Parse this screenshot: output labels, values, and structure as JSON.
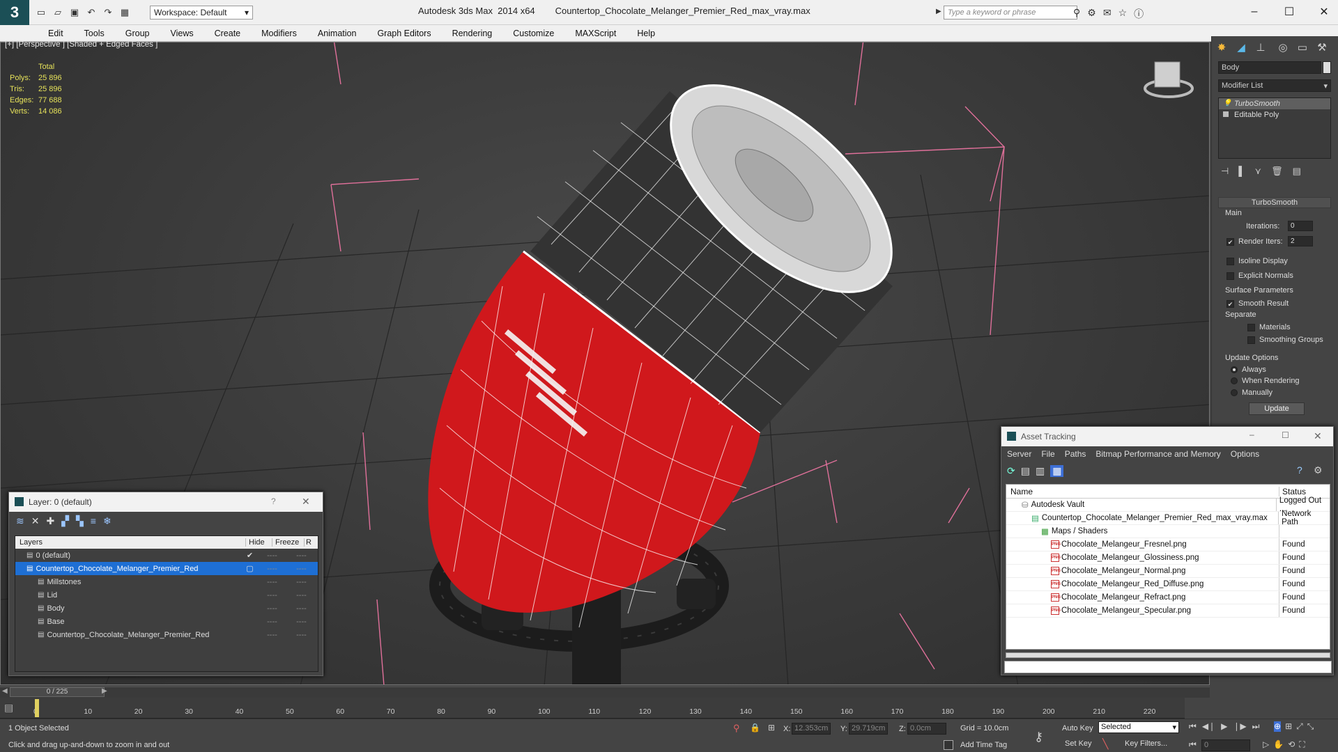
{
  "window": {
    "app_name": "Autodesk 3ds Max  2014 x64",
    "file_name": "Countertop_Chocolate_Melanger_Premier_Red_max_vray.max",
    "workspace": "Workspace: Default",
    "search_placeholder": "Type a keyword or phrase"
  },
  "menu": [
    "Edit",
    "Tools",
    "Group",
    "Views",
    "Create",
    "Modifiers",
    "Animation",
    "Graph Editors",
    "Rendering",
    "Customize",
    "MAXScript",
    "Help"
  ],
  "viewport": {
    "label": "[+] [Perspective ] [Shaded + Edged Faces ]",
    "stats": {
      "header": "Total",
      "rows": [
        {
          "k": "Polys:",
          "v": "25 896"
        },
        {
          "k": "Tris:",
          "v": "25 896"
        },
        {
          "k": "Edges:",
          "v": "77 688"
        },
        {
          "k": "Verts:",
          "v": "14 086"
        }
      ]
    }
  },
  "command_panel": {
    "object_name": "Body",
    "modifier_list": "Modifier List",
    "stack": [
      "TurboSmooth",
      "Editable Poly"
    ],
    "turbosmooth": {
      "title": "TurboSmooth",
      "main": "Main",
      "iterations_label": "Iterations:",
      "iterations": "0",
      "render_iters_label": "Render Iters:",
      "render_iters": "2",
      "isoline": "Isoline Display",
      "explicit_normals": "Explicit Normals",
      "surface_params": "Surface Parameters",
      "smooth_result": "Smooth Result",
      "separate": "Separate",
      "materials": "Materials",
      "smoothing_groups": "Smoothing Groups",
      "update_options": "Update Options",
      "always": "Always",
      "when_rendering": "When Rendering",
      "manually": "Manually",
      "update": "Update"
    }
  },
  "layer_dialog": {
    "title": "Layer: 0 (default)",
    "help": "?",
    "columns": {
      "layers": "Layers",
      "hide": "Hide",
      "freeze": "Freeze",
      "r": "R"
    },
    "rows": [
      {
        "name": "0 (default)",
        "indent": 1,
        "selected": false,
        "check": true
      },
      {
        "name": "Countertop_Chocolate_Melanger_Premier_Red",
        "indent": 1,
        "selected": true,
        "check": false
      },
      {
        "name": "Millstones",
        "indent": 2,
        "selected": false,
        "check": false
      },
      {
        "name": "Lid",
        "indent": 2,
        "selected": false,
        "check": false
      },
      {
        "name": "Body",
        "indent": 2,
        "selected": false,
        "check": false
      },
      {
        "name": "Base",
        "indent": 2,
        "selected": false,
        "check": false
      },
      {
        "name": "Countertop_Chocolate_Melanger_Premier_Red",
        "indent": 2,
        "selected": false,
        "check": false
      }
    ],
    "dash": "----"
  },
  "asset_tracking": {
    "title": "Asset Tracking",
    "menu": [
      "Server",
      "File",
      "Paths",
      "Bitmap Performance and Memory",
      "Options"
    ],
    "columns": {
      "name": "Name",
      "status": "Status"
    },
    "rows": [
      {
        "name": "Autodesk Vault",
        "status": "Logged Out ...",
        "level": 0,
        "icon": "vault"
      },
      {
        "name": "Countertop_Chocolate_Melanger_Premier_Red_max_vray.max",
        "status": "Network Path",
        "level": 1,
        "icon": "file"
      },
      {
        "name": "Maps / Shaders",
        "status": "",
        "level": 2,
        "icon": "maps"
      },
      {
        "name": "Chocolate_Melangeur_Fresnel.png",
        "status": "Found",
        "level": 3,
        "icon": "png"
      },
      {
        "name": "Chocolate_Melangeur_Glossiness.png",
        "status": "Found",
        "level": 3,
        "icon": "png"
      },
      {
        "name": "Chocolate_Melangeur_Normal.png",
        "status": "Found",
        "level": 3,
        "icon": "png"
      },
      {
        "name": "Chocolate_Melangeur_Red_Diffuse.png",
        "status": "Found",
        "level": 3,
        "icon": "png"
      },
      {
        "name": "Chocolate_Melangeur_Refract.png",
        "status": "Found",
        "level": 3,
        "icon": "png"
      },
      {
        "name": "Chocolate_Melangeur_Specular.png",
        "status": "Found",
        "level": 3,
        "icon": "png"
      }
    ]
  },
  "timeline": {
    "frame": "0 / 225",
    "ticks": [
      "0",
      "10",
      "20",
      "30",
      "40",
      "50",
      "60",
      "70",
      "80",
      "90",
      "100",
      "110",
      "120",
      "130",
      "140",
      "150",
      "160",
      "170",
      "180",
      "190",
      "200",
      "210",
      "220"
    ]
  },
  "status": {
    "selection": "1 Object Selected",
    "prompt": "Click and drag up-and-down to zoom in and out",
    "x_label": "X:",
    "x": "12.353cm",
    "y_label": "Y:",
    "y": "29.719cm",
    "z_label": "Z:",
    "z": "0.0cm",
    "grid": "Grid = 10.0cm",
    "add_time_tag": "Add Time Tag",
    "auto_key": "Auto Key",
    "auto_key_value": "Selected",
    "set_key": "Set Key",
    "key_filters": "Key Filters...",
    "frame_value": "0"
  },
  "colors": {
    "accent": "#1e6fd4",
    "model_red": "#d0181c",
    "model_dark": "#333333",
    "grid_pink": "#e0709a",
    "stats_yellow": "#e7e35a"
  }
}
